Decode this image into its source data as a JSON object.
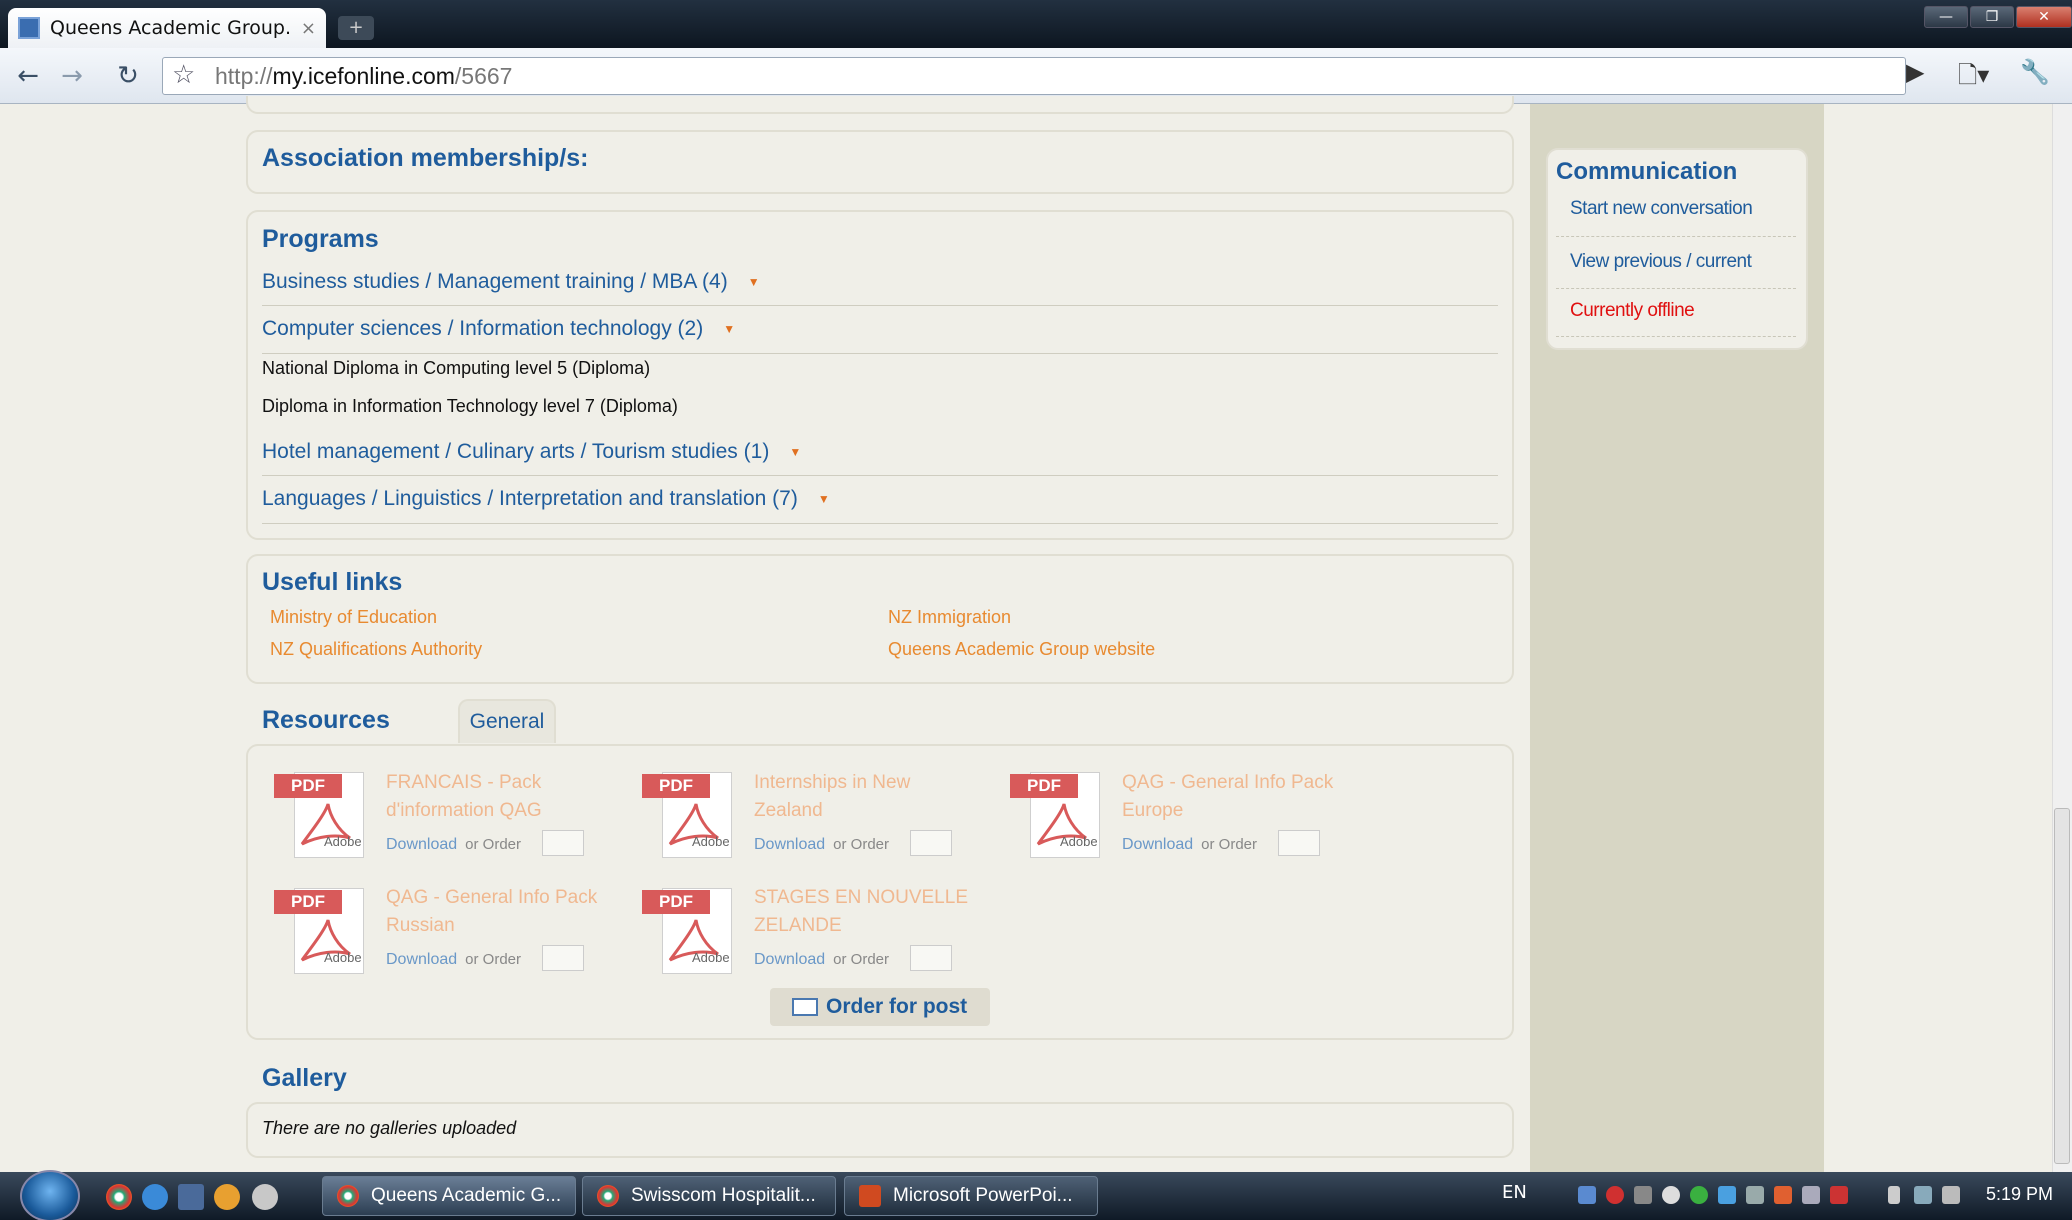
{
  "browser": {
    "tab_title": "Queens Academic Group...",
    "tab_close": "×",
    "new_tab": "+",
    "url_prefix": "http://",
    "url_domain": "my.icefonline.com",
    "url_path": "/5667",
    "window_controls": [
      "—",
      "❐",
      "✕"
    ]
  },
  "main": {
    "association_title": "Association membership/s:",
    "programs": {
      "title": "Programs",
      "categories": [
        {
          "label": "Business studies / Management training / MBA (4)"
        },
        {
          "label": "Computer sciences / Information technology (2)"
        },
        {
          "label": "Hotel management / Culinary arts / Tourism studies (1)"
        },
        {
          "label": "Languages / Linguistics / Interpretation and translation (7)"
        }
      ],
      "expanded_items": [
        "National Diploma in Computing level 5 (Diploma)",
        "Diploma in Information Technology level 7 (Diploma)"
      ]
    },
    "useful_links": {
      "title": "Useful links",
      "links": [
        "Ministry of Education",
        "NZ Immigration",
        "NZ Qualifications Authority",
        "Queens Academic Group website"
      ]
    },
    "resources": {
      "title": "Resources",
      "tab": "General",
      "pdf_tag": "PDF",
      "adobe_label": "Adobe",
      "download_label": "Download",
      "or_order_label": "or Order",
      "items": [
        {
          "title_line1": "FRANCAIS - Pack",
          "title_line2": "d'information QAG"
        },
        {
          "title_line1": "Internships in New",
          "title_line2": "Zealand"
        },
        {
          "title_line1": "QAG - General Info Pack",
          "title_line2": "Europe"
        },
        {
          "title_line1": "QAG - General Info Pack",
          "title_line2": "Russian"
        },
        {
          "title_line1": "STAGES EN NOUVELLE",
          "title_line2": "ZELANDE"
        }
      ],
      "order_button": "Order for post"
    },
    "gallery": {
      "title": "Gallery",
      "empty_text": "There are no galleries uploaded"
    }
  },
  "sidebar": {
    "communication": {
      "title": "Communication",
      "start": "Start new conversation",
      "view": "View previous / current",
      "status": "Currently offline",
      "status_color": "#e01010"
    }
  },
  "taskbar": {
    "tasks": [
      "Queens Academic G...",
      "Swisscom Hospitalit...",
      "Microsoft PowerPoi..."
    ],
    "language": "EN",
    "clock": "5:19 PM"
  }
}
